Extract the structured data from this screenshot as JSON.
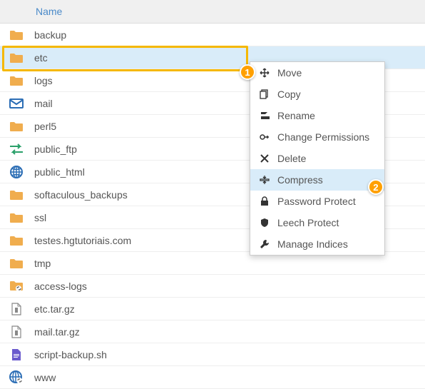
{
  "header": {
    "name": "Name"
  },
  "rows": [
    {
      "label": "backup",
      "type": "folder"
    },
    {
      "label": "etc",
      "type": "folder",
      "selected": true
    },
    {
      "label": "logs",
      "type": "folder"
    },
    {
      "label": "mail",
      "type": "mail"
    },
    {
      "label": "perl5",
      "type": "folder"
    },
    {
      "label": "public_ftp",
      "type": "ftp"
    },
    {
      "label": "public_html",
      "type": "globe"
    },
    {
      "label": "softaculous_backups",
      "type": "folder"
    },
    {
      "label": "ssl",
      "type": "folder"
    },
    {
      "label": "testes.hgtutoriais.com",
      "type": "folder"
    },
    {
      "label": "tmp",
      "type": "folder"
    },
    {
      "label": "access-logs",
      "type": "folderlink"
    },
    {
      "label": "etc.tar.gz",
      "type": "archive"
    },
    {
      "label": "mail.tar.gz",
      "type": "archive"
    },
    {
      "label": "script-backup.sh",
      "type": "script"
    },
    {
      "label": "www",
      "type": "globelink"
    }
  ],
  "menu": {
    "items": [
      {
        "label": "Move",
        "icon": "move"
      },
      {
        "label": "Copy",
        "icon": "copy"
      },
      {
        "label": "Rename",
        "icon": "rename"
      },
      {
        "label": "Change Permissions",
        "icon": "key"
      },
      {
        "label": "Delete",
        "icon": "delete"
      },
      {
        "label": "Compress",
        "icon": "compress",
        "selected": true
      },
      {
        "label": "Password Protect",
        "icon": "lock"
      },
      {
        "label": "Leech Protect",
        "icon": "shield"
      },
      {
        "label": "Manage Indices",
        "icon": "wrench"
      }
    ]
  },
  "callouts": {
    "c1": "1",
    "c2": "2"
  }
}
